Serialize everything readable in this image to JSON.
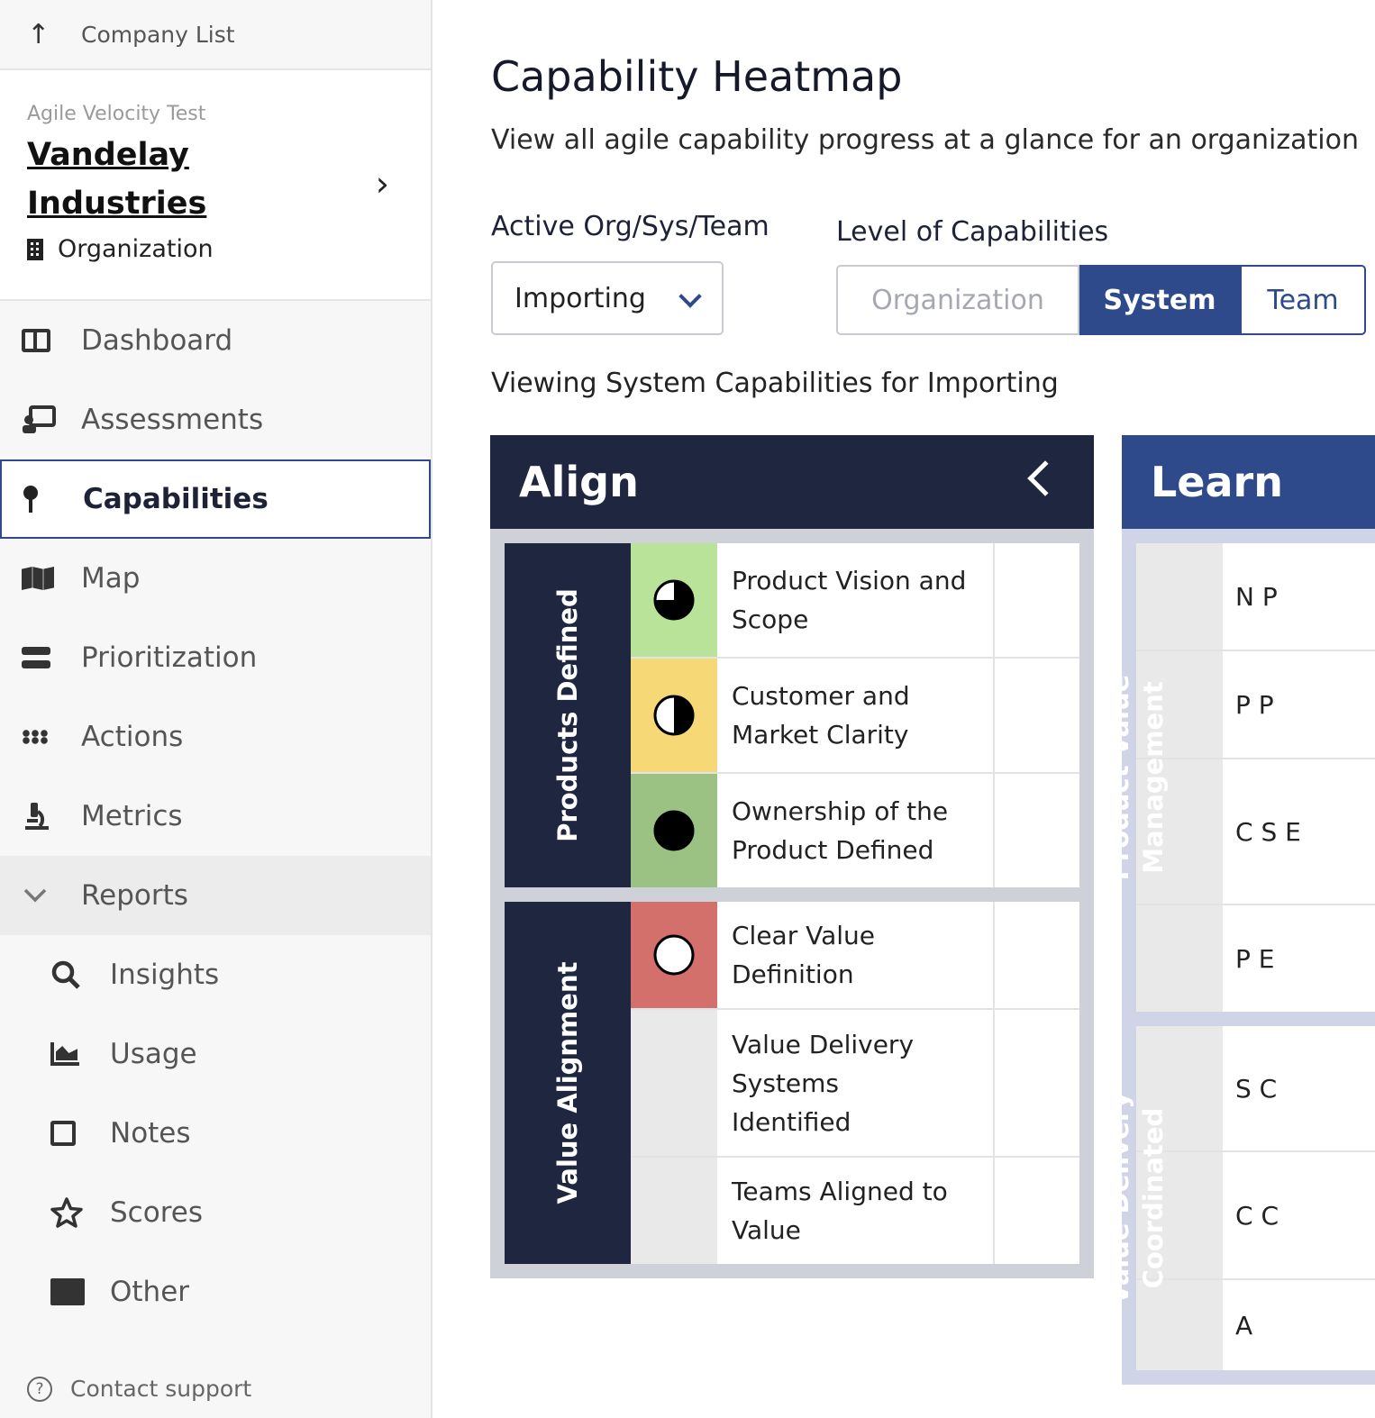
{
  "sidebar": {
    "back_label": "Company List",
    "org_subtitle": "Agile Velocity Test",
    "org_name": "Vandelay Industries",
    "org_type": "Organization",
    "nav": [
      {
        "label": "Dashboard",
        "icon": "dashboard-icon"
      },
      {
        "label": "Assessments",
        "icon": "assessments-icon"
      },
      {
        "label": "Capabilities",
        "icon": "pin-icon",
        "active": true
      },
      {
        "label": "Map",
        "icon": "map-icon"
      },
      {
        "label": "Prioritization",
        "icon": "prioritization-icon"
      },
      {
        "label": "Actions",
        "icon": "grid-dots-icon"
      },
      {
        "label": "Metrics",
        "icon": "microscope-icon"
      },
      {
        "label": "Reports",
        "icon": "chevron-down-icon",
        "expanded": true
      }
    ],
    "reports_sub": [
      {
        "label": "Insights",
        "icon": "search-icon"
      },
      {
        "label": "Usage",
        "icon": "area-chart-icon"
      },
      {
        "label": "Notes",
        "icon": "note-icon"
      },
      {
        "label": "Scores",
        "icon": "star-icon"
      },
      {
        "label": "Other",
        "icon": "box-arrow-icon"
      }
    ],
    "contact": "Contact support"
  },
  "main": {
    "title": "Capability Heatmap",
    "subtitle": "View all agile capability progress at a glance for an organization",
    "active_label": "Active Org/Sys/Team",
    "active_value": "Importing",
    "level_label": "Level of Capabilities",
    "levels": [
      "Organization",
      "System",
      "Team"
    ],
    "selected_level": "System",
    "viewing": "Viewing System Capabilities for Importing"
  },
  "colors": {
    "navy": "#1e2640",
    "blue": "#2f4a8a",
    "green_light": "#b9e398",
    "yellow": "#f7d877",
    "green_dark": "#9cc283",
    "red": "#d4706b",
    "empty": "#e9e9e9"
  },
  "align": {
    "title": "Align",
    "groups": [
      {
        "name": "Products Defined",
        "rows": [
          {
            "name": "Product Vision and Scope",
            "status": "three-quarter",
            "color": "#b9e398"
          },
          {
            "name": "Customer and Market Clarity",
            "status": "half",
            "color": "#f7d877"
          },
          {
            "name": "Ownership of the Product Defined",
            "status": "full",
            "color": "#9cc283"
          }
        ]
      },
      {
        "name": "Value Alignment",
        "rows": [
          {
            "name": "Clear Value Definition",
            "status": "empty",
            "color": "#d4706b"
          },
          {
            "name": "Value Delivery Systems Identified",
            "status": "none",
            "color": "#e9e9e9"
          },
          {
            "name": "Teams Aligned to Value",
            "status": "none",
            "color": "#e9e9e9"
          }
        ]
      }
    ]
  },
  "learn": {
    "title": "Learn",
    "groups": [
      {
        "name": "Product Value Management",
        "rows": [
          "N P",
          "P P",
          "C S E",
          "P E"
        ]
      },
      {
        "name": "Value Delivery Coordinated",
        "rows": [
          "S C",
          "C C",
          "A"
        ]
      }
    ]
  }
}
